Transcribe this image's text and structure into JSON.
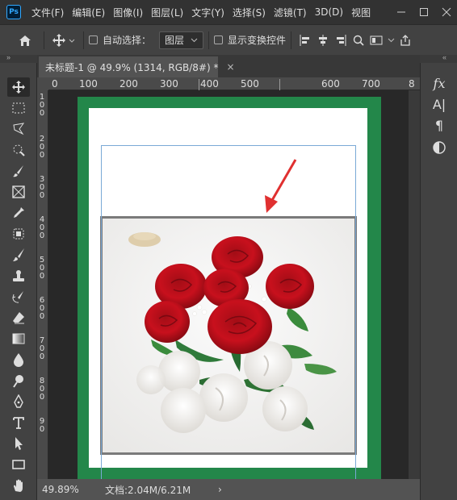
{
  "app": {
    "logo": "Ps"
  },
  "menu": [
    "文件(F)",
    "编辑(E)",
    "图像(I)",
    "图层(L)",
    "文字(Y)",
    "选择(S)",
    "滤镜(T)",
    "3D(D)",
    "视图"
  ],
  "options": {
    "auto_select_label": "自动选择：",
    "layer_dropdown": "图层",
    "show_transform_label": "显示变换控件"
  },
  "collapse_left": "»",
  "collapse_right": "«",
  "document": {
    "tab_title": "未标题-1 @ 49.9% (1314, RGB/8#) *",
    "close": "×",
    "ruler_top": [
      "0",
      "100",
      "200",
      "300",
      "400",
      "500",
      "600",
      "700"
    ],
    "ruler_left": [
      "1",
      "0",
      "0",
      "2",
      "0",
      "0",
      "3",
      "0",
      "0",
      "4",
      "0",
      "0",
      "5",
      "0",
      "0",
      "6",
      "0",
      "0",
      "7",
      "0",
      "0",
      "8",
      "0",
      "0",
      "9",
      "0"
    ],
    "ruler_right_glyph": "8"
  },
  "status": {
    "zoom": "49.89%",
    "doc_info": "文档:2.04M/6.21M",
    "arrow": "›"
  },
  "right_panel": {
    "fx": "fx",
    "char": "A|",
    "para": "¶",
    "adjust_icon": "half-circle"
  },
  "colors": {
    "frame_green": "#23874a",
    "annotation_arrow": "#e03030"
  }
}
